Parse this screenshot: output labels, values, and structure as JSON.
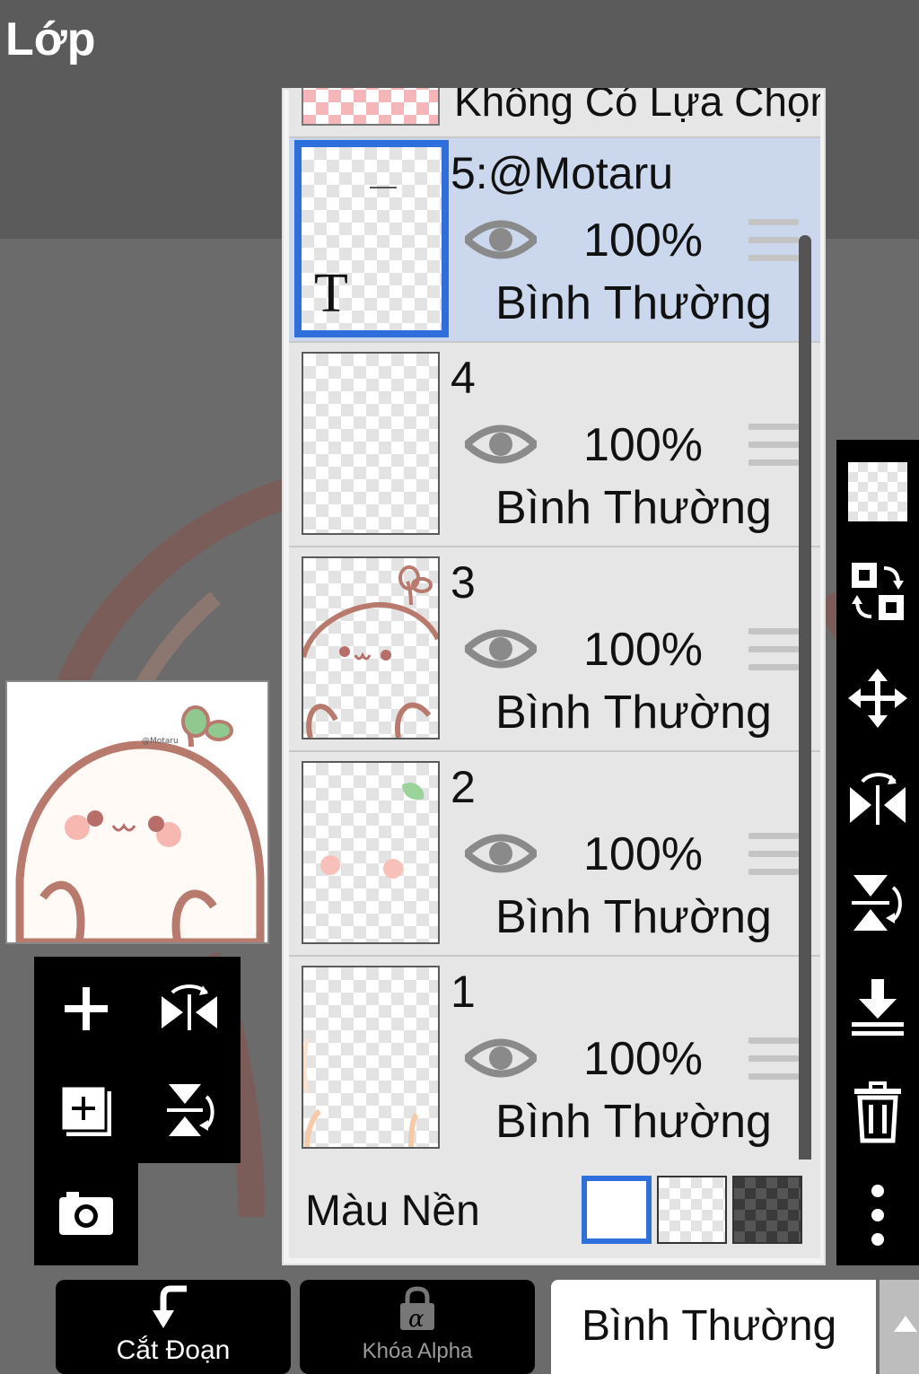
{
  "header": {
    "title": "Lớp"
  },
  "layer_panel": {
    "no_selection": "Không Có Lựa Chọn",
    "layers": [
      {
        "name": "5:@Motaru",
        "opacity": "100%",
        "blend": "Bình Thường",
        "selected": true,
        "type_badge": "T"
      },
      {
        "name": "4",
        "opacity": "100%",
        "blend": "Bình Thường",
        "selected": false
      },
      {
        "name": "3",
        "opacity": "100%",
        "blend": "Bình Thường",
        "selected": false
      },
      {
        "name": "2",
        "opacity": "100%",
        "blend": "Bình Thường",
        "selected": false
      },
      {
        "name": "1",
        "opacity": "100%",
        "blend": "Bình Thường",
        "selected": false
      }
    ],
    "background_label": "Màu Nền"
  },
  "bottom_bar": {
    "clip_label": "Cắt Đoạn",
    "alpha_lock_label": "Khóa Alpha",
    "blend_mode_value": "Bình Thường"
  },
  "right_toolbar": {
    "icons": [
      "checker-icon",
      "swap-layer-icon",
      "move-icon",
      "flip-horizontal-icon",
      "flip-vertical-icon",
      "merge-down-icon",
      "trash-icon",
      "more-icon"
    ]
  },
  "left_toolbar": {
    "icons": [
      "add-icon",
      "flip-horizontal-icon",
      "add-layer-icon",
      "flip-vertical-icon",
      "camera-icon"
    ]
  },
  "colors": {
    "accent": "#2f6fdc",
    "selected_row": "#cad7ec",
    "panel": "#e6e6e6",
    "toolbar": "#000000"
  }
}
